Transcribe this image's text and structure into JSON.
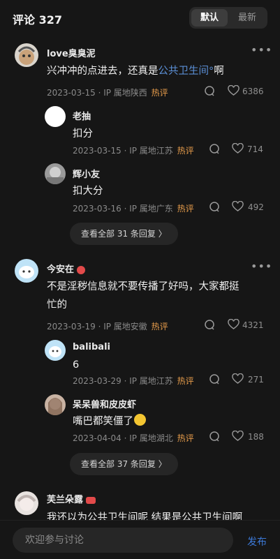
{
  "header": {
    "title": "评论 327",
    "tab_default": "默认",
    "tab_latest": "最新"
  },
  "comments": [
    {
      "user": "love臭臭泥",
      "text_before": "兴冲冲的点进去，还真是",
      "text_link": "公共卫生间°",
      "text_after": "啊",
      "date": "2023-03-15",
      "ip": "IP 属地陕西",
      "hot": "热评",
      "likes": "6386",
      "replies": [
        {
          "user": "老抽",
          "text": "扣分",
          "date": "2023-03-15",
          "ip": "IP 属地江苏",
          "hot": "热评",
          "likes": "714"
        },
        {
          "user": "辉小友",
          "text": "扣大分",
          "date": "2023-03-16",
          "ip": "IP 属地广东",
          "hot": "热评",
          "likes": "492"
        }
      ],
      "more_label": "查看全部 31 条回复 〉"
    },
    {
      "user": "今安在",
      "text_line1": "不是淫秽信息就不要传播了好吗，大家都挺",
      "text_line2": "忙的",
      "date": "2023-03-19",
      "ip": "IP 属地安徽",
      "hot": "热评",
      "likes": "4321",
      "replies": [
        {
          "user": "balibali",
          "text": "6",
          "date": "2023-03-29",
          "ip": "IP 属地江苏",
          "hot": "热评",
          "likes": "271"
        },
        {
          "user": "呆呆兽和皮皮虾",
          "text": "嘴巴都笑僵了",
          "date": "2023-04-04",
          "ip": "IP 属地湖北",
          "hot": "热评",
          "likes": "188"
        }
      ],
      "more_label": "查看全部 37 条回复 〉"
    },
    {
      "user": "芙兰朵露",
      "text_line1": "我还以为公共卫生间呢 结果是公共卫生间啊"
    }
  ],
  "composer": {
    "placeholder": "欢迎参与讨论",
    "publish_label": "发布"
  },
  "colors": {
    "background": "#161616",
    "accent": "#3c79d8",
    "hot": "#e39a4a",
    "link": "#5b8fd6"
  }
}
